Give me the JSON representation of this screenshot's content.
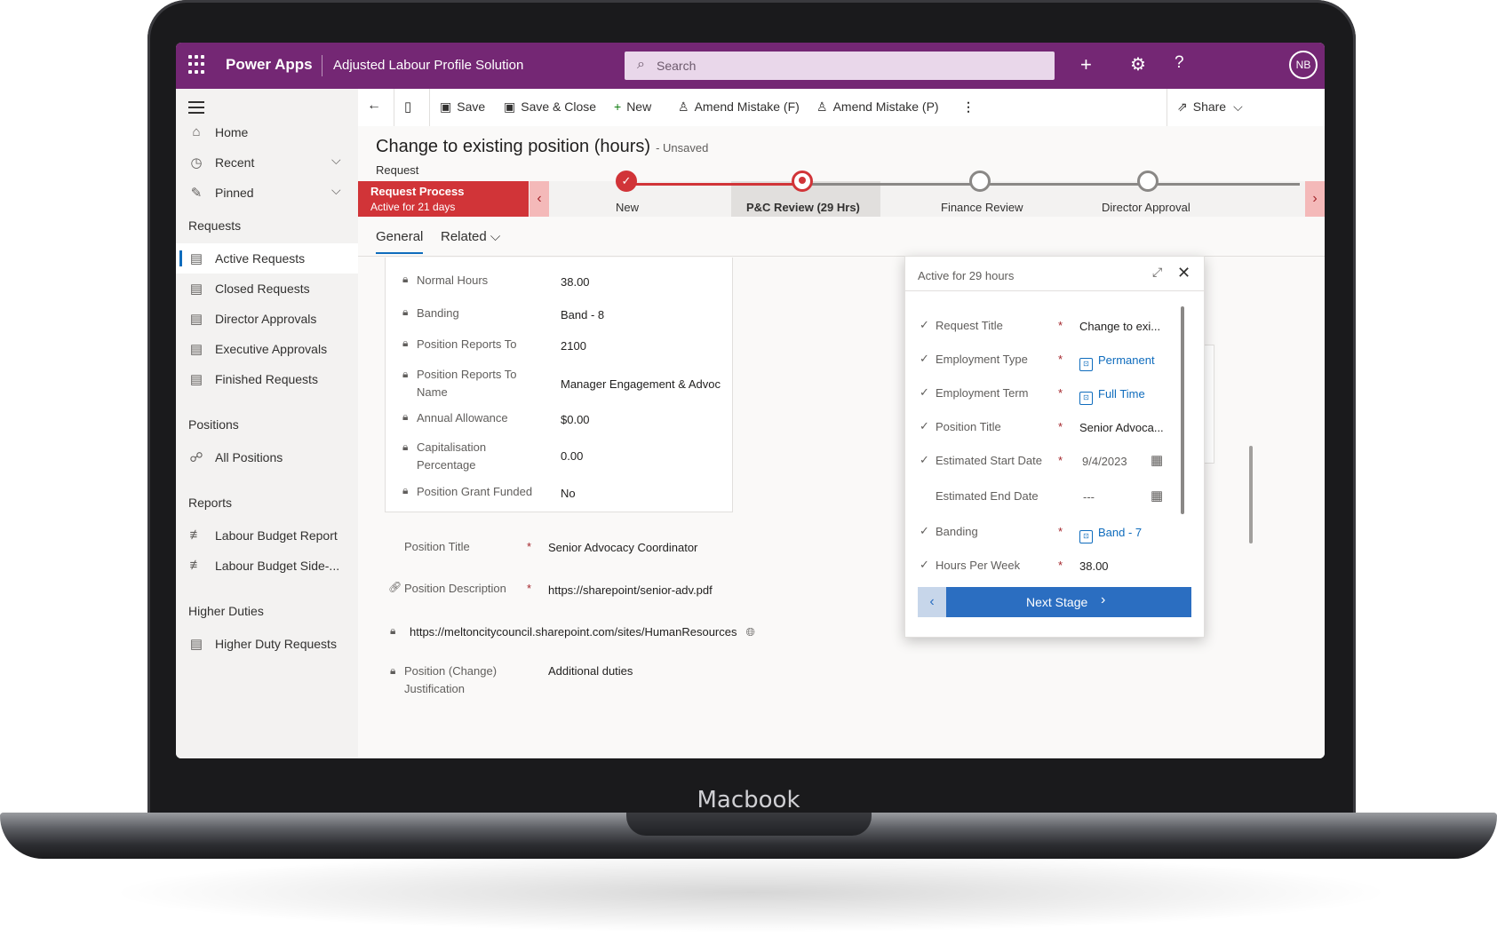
{
  "device": {
    "label": "Macbook"
  },
  "topbar": {
    "app_name": "Power Apps",
    "solution": "Adjusted Labour Profile Solution",
    "search_placeholder": "Search",
    "avatar_initials": "NB"
  },
  "nav": {
    "home": "Home",
    "recent": "Recent",
    "pinned": "Pinned",
    "group_requests": "Requests",
    "requests": [
      "Active Requests",
      "Closed Requests",
      "Director Approvals",
      "Executive Approvals",
      "Finished Requests"
    ],
    "group_positions": "Positions",
    "positions": [
      "All Positions"
    ],
    "group_reports": "Reports",
    "reports": [
      "Labour Budget Report",
      "Labour Budget Side-..."
    ],
    "group_higher": "Higher Duties",
    "higher": [
      "Higher Duty Requests"
    ]
  },
  "commands": {
    "save": "Save",
    "save_close": "Save & Close",
    "new": "New",
    "amend_f": "Amend Mistake (F)",
    "amend_p": "Amend Mistake (P)",
    "share": "Share"
  },
  "record": {
    "title": "Change to existing position (hours)",
    "status": "- Unsaved",
    "entity": "Request"
  },
  "process": {
    "name": "Request Process",
    "duration": "Active for 21 days",
    "stages": [
      "New",
      "P&C Review  (29 Hrs)",
      "Finance Review",
      "Director Approval"
    ],
    "colors": {
      "complete": "#d13438",
      "pending": "#8a8886"
    }
  },
  "tabs": {
    "general": "General",
    "related": "Related"
  },
  "form": {
    "fields": [
      {
        "label": "Normal Hours",
        "value": "38.00"
      },
      {
        "label": "Banding",
        "value": "Band - 8"
      },
      {
        "label": "Position Reports To",
        "value": "2100"
      },
      {
        "label": "Position Reports To Name",
        "value": "Manager Engagement & Advoc"
      },
      {
        "label": "Annual Allowance",
        "value": "$0.00"
      },
      {
        "label": "Capitalisation Percentage",
        "value": "0.00"
      },
      {
        "label": "Position Grant Funded",
        "value": "No"
      }
    ],
    "position_title_label": "Position Title",
    "position_title_value": "Senior Advocacy Coordinator",
    "position_desc_label": "Position Description",
    "position_desc_value": "https://sharepoint/senior-adv.pdf",
    "sharepoint_url": "https://meltoncitycouncil.sharepoint.com/sites/HumanResources",
    "justification_label": "Position (Change) Justification",
    "justification_value": "Additional duties"
  },
  "flyout": {
    "header": "Active for 29 hours",
    "steps": [
      {
        "label": "Request Title",
        "value": "Change to exi..."
      },
      {
        "label": "Employment Type",
        "value": "Permanent"
      },
      {
        "label": "Employment Term",
        "value": "Full Time"
      },
      {
        "label": "Position Title",
        "value": "Senior Advoca..."
      },
      {
        "label": "Estimated Start Date",
        "value": "9/4/2023"
      },
      {
        "label": "Estimated End Date",
        "value": "---"
      },
      {
        "label": "Banding",
        "value": "Band - 7"
      },
      {
        "label": "Hours Per Week",
        "value": "38.00"
      }
    ],
    "next_stage": "Next Stage"
  }
}
